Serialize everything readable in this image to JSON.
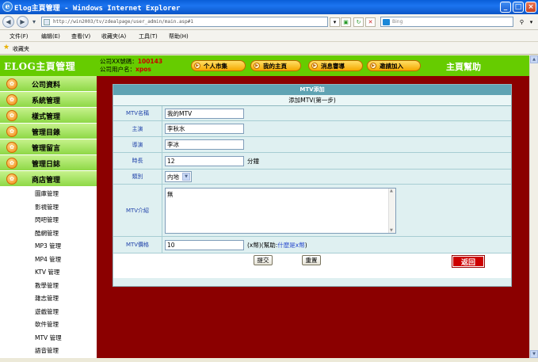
{
  "window": {
    "title": "Elog主頁管理 - Windows Internet Explorer",
    "address": "http://win2003/tv/zdealpage/user_admin/main.asp#1",
    "search_placeholder": "Bing",
    "controls": {
      "min": "_",
      "max": "□",
      "close": "×"
    }
  },
  "menu": [
    "文件(F)",
    "编辑(E)",
    "查看(V)",
    "收藏夹(A)",
    "工具(T)",
    "帮助(H)"
  ],
  "favorites_label": "收藏夹",
  "header": {
    "logo": "ELOG主頁管理",
    "account_label": "公司XX號碼：",
    "account_value": "100143",
    "user_label": "公司用户名：",
    "user_value": "xpos",
    "buttons": [
      "个人市集",
      "我的主頁",
      "消息響導",
      "邀請加入"
    ],
    "help": "主頁幫助"
  },
  "sidebar": {
    "sections": [
      "公司資料",
      "系統管理",
      "樣式管理",
      "管理目錄",
      "管理留言",
      "管理日誌",
      "商店管理"
    ],
    "sub_items": [
      "圖庫管理",
      "影視管理",
      "閃吧管理",
      "酷網管理",
      "MP3 管理",
      "MP4 管理",
      "KTV 管理",
      "教學管理",
      "雜志管理",
      "遊戲管理",
      "軟件管理",
      "MTV 管理",
      "語音管理"
    ]
  },
  "form": {
    "title": "MTV添加",
    "subtitle": "添加MTV(第一步)",
    "fields": {
      "name": {
        "label": "MTV名稱",
        "value": "我的MTV"
      },
      "star": {
        "label": "主演",
        "value": "李秋水"
      },
      "director": {
        "label": "導演",
        "value": "李冰"
      },
      "duration": {
        "label": "時長",
        "value": "12",
        "unit": "分鐘"
      },
      "category": {
        "label": "類別",
        "value": "内地"
      },
      "intro": {
        "label": "MTV介紹",
        "value": "無"
      },
      "price": {
        "label": "MTV價格",
        "value": "10",
        "unit_prefix": "(x幣)(幫助:",
        "unit_link": "什麽是x幣",
        "unit_suffix": ")"
      }
    },
    "submit": "提交",
    "reset": "重置",
    "back": "返回"
  }
}
